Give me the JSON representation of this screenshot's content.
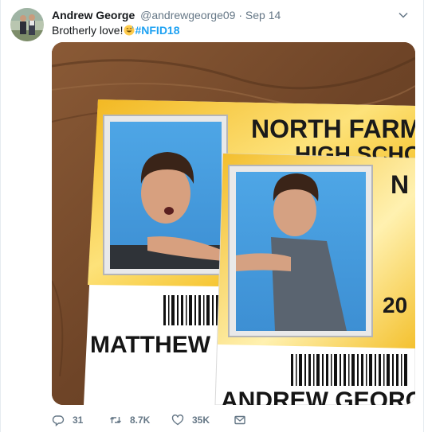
{
  "tweet": {
    "author_name": "Andrew George",
    "handle": "@andrewgeorge09",
    "separator": "·",
    "date": "Sep 14",
    "text": "Brotherly love!",
    "hashtag": "#NFID18"
  },
  "photo": {
    "card_back": {
      "school_line1": "NORTH FARMI",
      "school_line2_partial": "HIGH SCHO",
      "student_name": "MATTHEW"
    },
    "card_front": {
      "school_partial": "N",
      "year_partial": "20",
      "student_name": "ANDREW GEORG"
    }
  },
  "actions": {
    "reply_count": "31",
    "retweet_count": "8.7K",
    "like_count": "35K"
  },
  "icons": {
    "avatar": "avatar-photo",
    "caret": "chevron-down-icon",
    "emoji": "smiling-face-with-sweat-emoji",
    "reply": "reply-icon",
    "retweet": "retweet-icon",
    "like": "heart-icon",
    "dm": "envelope-icon"
  },
  "colors": {
    "hashtag": "#1da1f2",
    "secondary_text": "#657786",
    "card_yellow": "#f6c531"
  }
}
